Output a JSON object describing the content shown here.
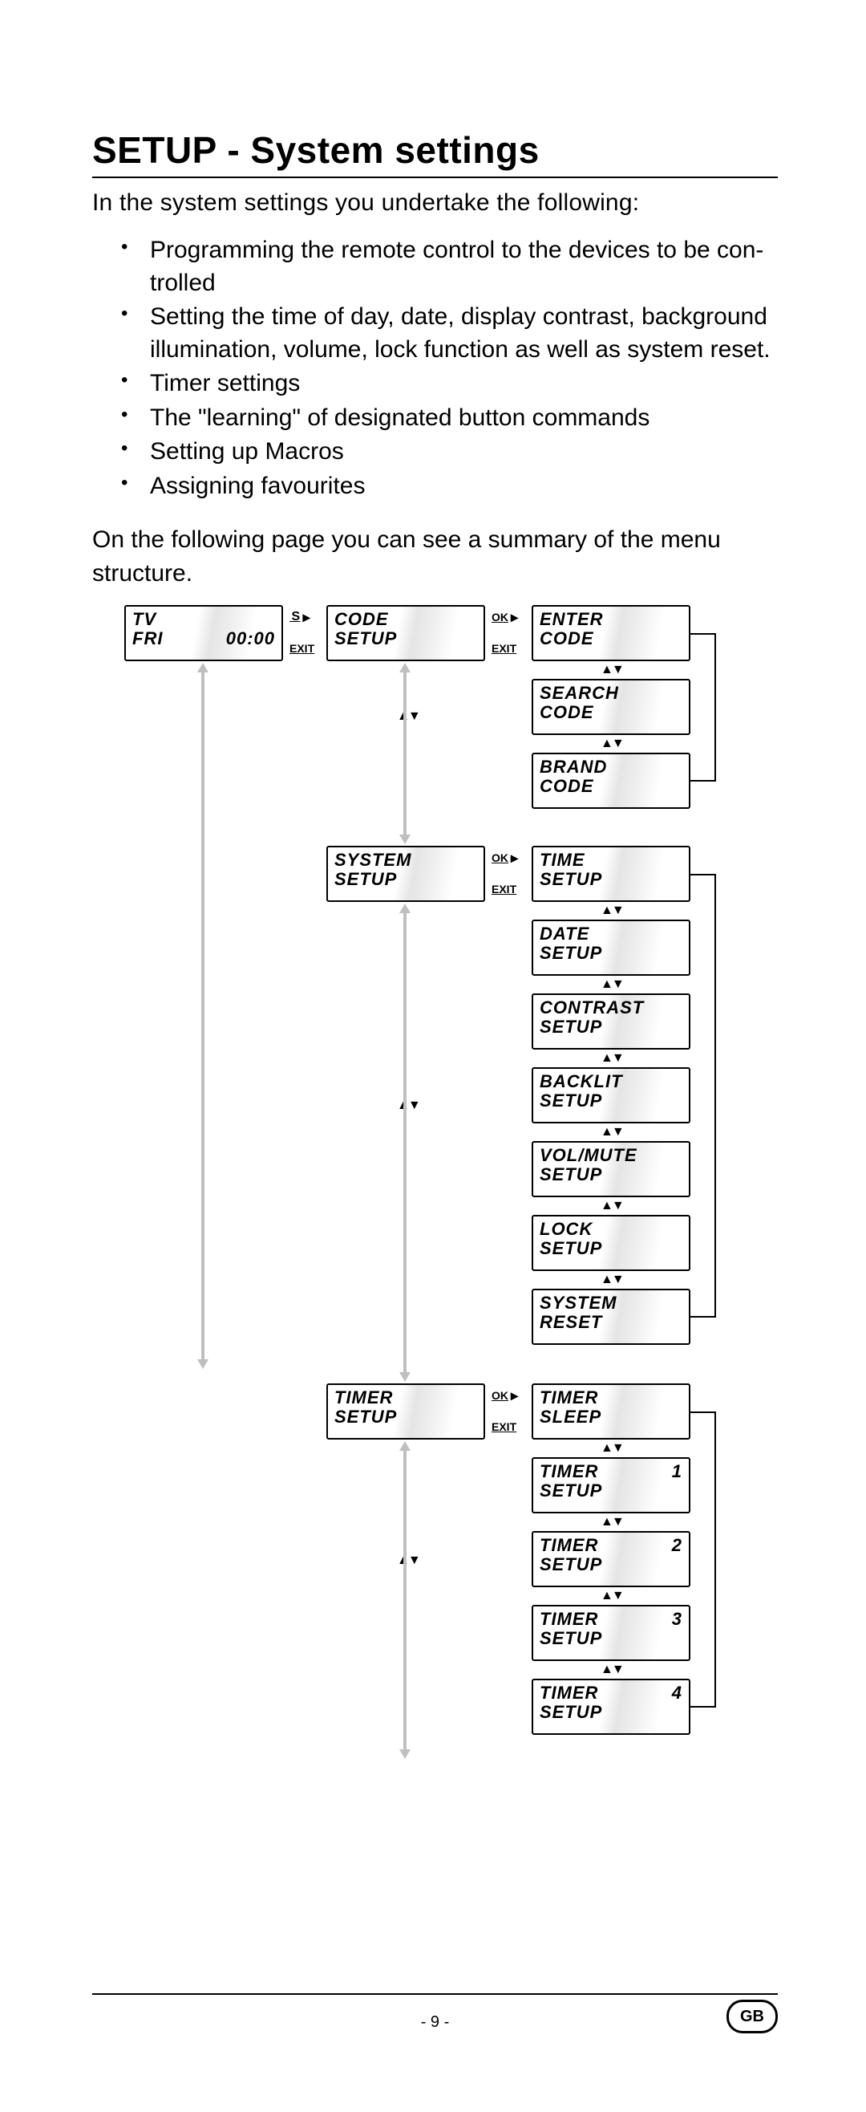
{
  "title": "SETUP - System settings",
  "intro": "In the system settings you undertake the following:",
  "bullets": [
    "Programming the remote control to the devices to be con- trolled",
    "Setting the time of day, date, display contrast, background illumination, volume, lock function as well as system reset.",
    "Timer settings",
    "The \"learning\" of designated button commands",
    "Setting up Macros",
    "Assigning favourites"
  ],
  "after": "On the following page you can see a summary of the menu structure.",
  "labels": {
    "s": "S",
    "exit": "EXIT",
    "ok": "OK"
  },
  "lcd": {
    "home": {
      "l1a": "TV",
      "l2a": "FRI",
      "l2b": "00:00"
    },
    "code_setup": {
      "l1": "CODE",
      "l2": "SETUP"
    },
    "enter_code": {
      "l1": "ENTER",
      "l2": "CODE"
    },
    "search_code": {
      "l1": "SEARCH",
      "l2": "CODE"
    },
    "brand_code": {
      "l1": "BRAND",
      "l2": "CODE"
    },
    "system_setup": {
      "l1": "SYSTEM",
      "l2": "SETUP"
    },
    "time_setup": {
      "l1": "TIME",
      "l2": "SETUP"
    },
    "date_setup": {
      "l1": "DATE",
      "l2": "SETUP"
    },
    "contrast_setup": {
      "l1": "CONTRAST",
      "l2": "SETUP"
    },
    "backlit_setup": {
      "l1": "BACKLIT",
      "l2": "SETUP"
    },
    "volmute_setup": {
      "l1": "VOL/MUTE",
      "l2": "SETUP"
    },
    "lock_setup": {
      "l1": "LOCK",
      "l2": "SETUP"
    },
    "system_reset": {
      "l1": "SYSTEM",
      "l2": "RESET"
    },
    "timer_setup": {
      "l1": "TIMER",
      "l2": "SETUP"
    },
    "timer_sleep": {
      "l1": "TIMER",
      "l2": "SLEEP"
    },
    "timer1": {
      "l1a": "TIMER",
      "l1b": "1",
      "l2": "SETUP"
    },
    "timer2": {
      "l1a": "TIMER",
      "l1b": "2",
      "l2": "SETUP"
    },
    "timer3": {
      "l1a": "TIMER",
      "l1b": "3",
      "l2": "SETUP"
    },
    "timer4": {
      "l1a": "TIMER",
      "l1b": "4",
      "l2": "SETUP"
    }
  },
  "footer": {
    "page": "- 9 -",
    "country": "GB"
  }
}
